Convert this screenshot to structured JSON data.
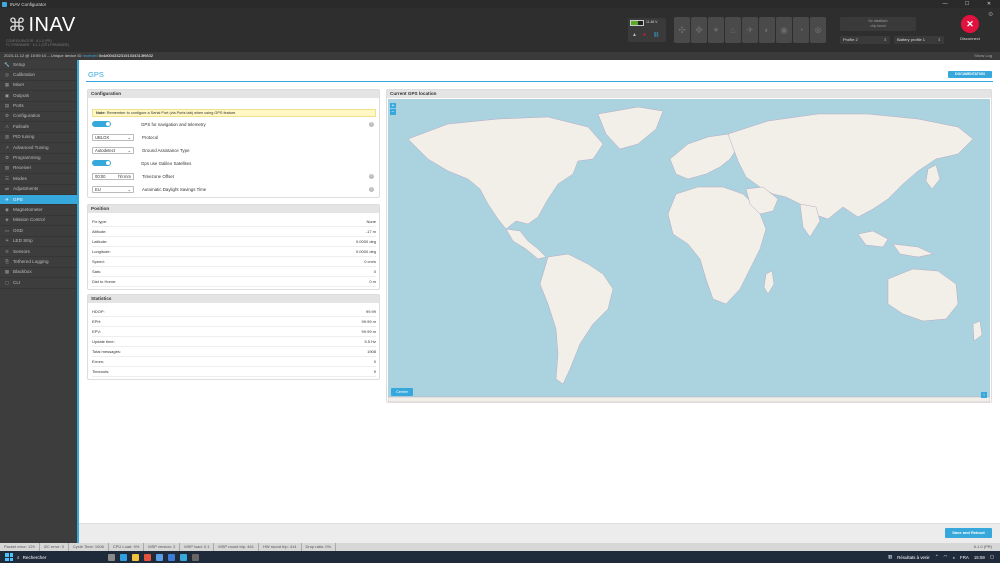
{
  "window": {
    "title": "INAV Configurator",
    "controls": [
      "—",
      "☐",
      "✕"
    ]
  },
  "header": {
    "logo": "INAV",
    "logo_mark": "⌘",
    "logo_sub1": "CONFIGURATOR · 6.1.0 (PR)",
    "logo_sub2": "FC FIRMWARE · 6.1.1 (SITLFIRMWARE)",
    "battery_voltage": "11.46 V",
    "no_profile_text": "No dataflash\nchip found",
    "profile": "Profile 2",
    "battery_profile": "Battery profile 1",
    "disconnect": "Disconnect"
  },
  "statusline": {
    "datetime": "2023-11-12 @ 15:59:10",
    "uid_prefix": "-- Unique device ID",
    "uid_label": "received",
    "uid": "0x4d0043323151034313f9832",
    "show_log": "Show Log"
  },
  "sidebar": {
    "items": [
      {
        "icon": "🔧",
        "label": "Setup"
      },
      {
        "icon": "◎",
        "label": "Calibration"
      },
      {
        "icon": "▦",
        "label": "Mixer"
      },
      {
        "icon": "▣",
        "label": "Outputs"
      },
      {
        "icon": "▤",
        "label": "Ports"
      },
      {
        "icon": "⚙",
        "label": "Configuration"
      },
      {
        "icon": "⚠",
        "label": "Failsafe"
      },
      {
        "icon": "▥",
        "label": "PID tuning"
      },
      {
        "icon": "↗",
        "label": "Advanced Tuning"
      },
      {
        "icon": "⚙",
        "label": "Programming"
      },
      {
        "icon": "▧",
        "label": "Receiver"
      },
      {
        "icon": "☰",
        "label": "Modes"
      },
      {
        "icon": "⇄",
        "label": "Adjustments"
      },
      {
        "icon": "✈",
        "label": "GPS"
      },
      {
        "icon": "◉",
        "label": "Magnetometer"
      },
      {
        "icon": "◈",
        "label": "Mission Control"
      },
      {
        "icon": "▭",
        "label": "OSD"
      },
      {
        "icon": "☀",
        "label": "LED Strip"
      },
      {
        "icon": "≋",
        "label": "Sensors"
      },
      {
        "icon": "⎘",
        "label": "Tethered Logging"
      },
      {
        "icon": "▩",
        "label": "Blackbox"
      },
      {
        "icon": "▢",
        "label": "CLI"
      }
    ]
  },
  "page": {
    "title": "GPS",
    "doc_button": "DOCUMENTATION"
  },
  "config": {
    "title": "Configuration",
    "note_bold": "Note:",
    "note": "Remember to configure a Serial Port (via Ports tab) when using GPS feature.",
    "gps_toggle_label": "GPS for navigation and telemetry",
    "protocol_value": "UBLOX",
    "protocol_label": "Protocol",
    "assist_value": "Autodetect",
    "assist_label": "Ground Assistance Type",
    "galileo_label": "Gps use Galileo Satellites",
    "tz_value": "00:00",
    "tz_placeholder": "hh:mm",
    "tz_label": "Timezone Offset",
    "dst_value": "EU",
    "dst_label": "Automatic Daylight Savings Time"
  },
  "position": {
    "title": "Position",
    "rows": [
      {
        "k": "Fix type:",
        "v": "None"
      },
      {
        "k": "Altitude:",
        "v": "-17 m"
      },
      {
        "k": "Latitude:",
        "v": "0.0000 deg"
      },
      {
        "k": "Longitude:",
        "v": "0.0000 deg"
      },
      {
        "k": "Speed:",
        "v": "0 cm/s"
      },
      {
        "k": "Sats:",
        "v": "0"
      },
      {
        "k": "Dist to Home:",
        "v": "0 m"
      }
    ]
  },
  "stats": {
    "title": "Statistics",
    "rows": [
      {
        "k": "HDOP:",
        "v": "99.99"
      },
      {
        "k": "EPH:",
        "v": "99.99 m"
      },
      {
        "k": "EPV:",
        "v": "99.99 m"
      },
      {
        "k": "Update time:",
        "v": "5.5 Hz"
      },
      {
        "k": "Total messages:",
        "v": "1908"
      },
      {
        "k": "Errors:",
        "v": "0"
      },
      {
        "k": "Timeouts:",
        "v": "9"
      }
    ]
  },
  "map": {
    "title": "Current GPS location",
    "zoom_in": "+",
    "zoom_out": "−",
    "center": "Center",
    "corner": "i"
  },
  "actions": {
    "save": "Save and Reboot"
  },
  "footer": {
    "items": [
      "Packet error: 129",
      "I2C error: 0",
      "Cycle Time: 1006",
      "CPU Load: 9%",
      "MSP version: 2",
      "MSP load: 0.1",
      "MSP round trip: 461",
      "HW round trip: 414",
      "Drop ratio: 0%"
    ],
    "version": "6.1.0 (PR)"
  },
  "taskbar": {
    "search": "Rechercher",
    "news": "Résultats à venir",
    "time": "15:59",
    "lang": "FRA"
  },
  "colors": {
    "accent": "#37a8db",
    "danger": "#e2123f",
    "ok": "#59aa29"
  }
}
